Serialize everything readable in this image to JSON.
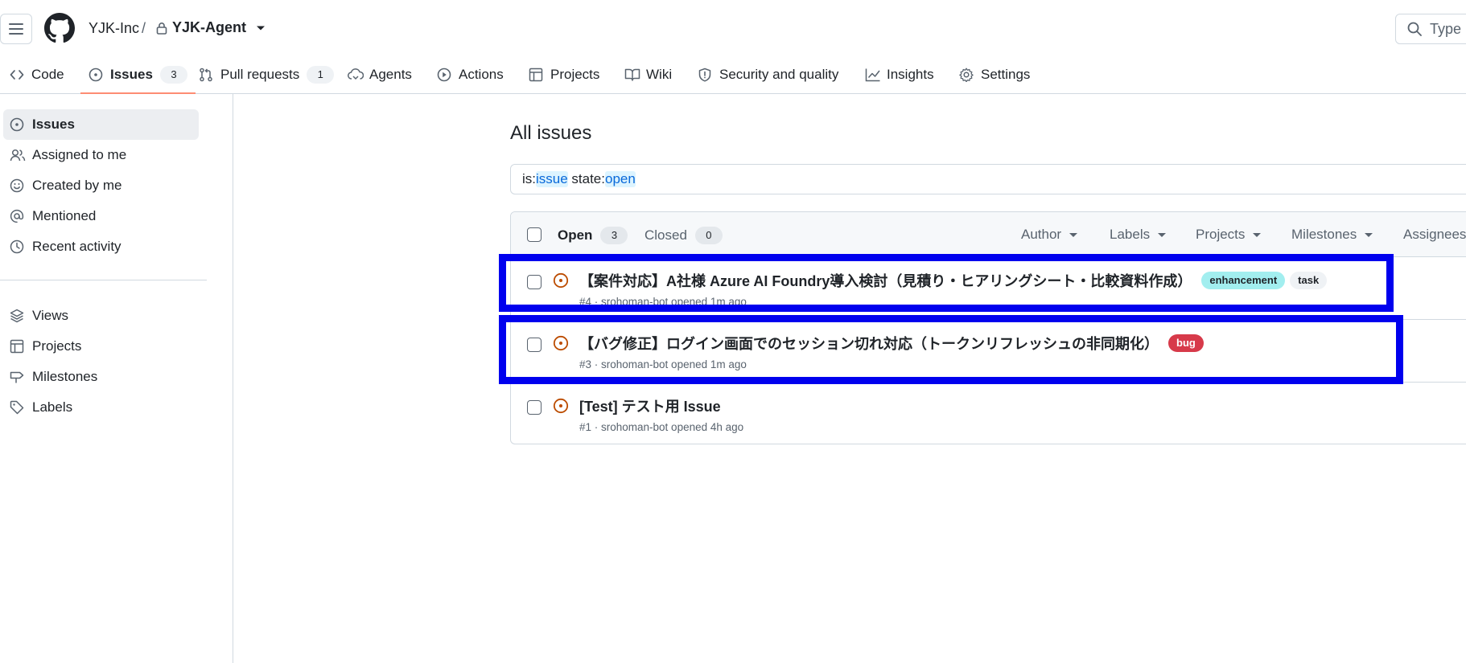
{
  "header": {
    "owner": "YJK-Inc",
    "separator": "/",
    "repo": "YJK-Agent",
    "search_placeholder": "Type ["
  },
  "repo_nav": {
    "code": "Code",
    "issues": "Issues",
    "issues_count": "3",
    "pull_requests": "Pull requests",
    "pull_requests_count": "1",
    "agents": "Agents",
    "actions": "Actions",
    "projects": "Projects",
    "wiki": "Wiki",
    "security": "Security and quality",
    "insights": "Insights",
    "settings": "Settings"
  },
  "sidebar": {
    "items": [
      {
        "label": "Issues",
        "icon": "issue-opened-icon"
      },
      {
        "label": "Assigned to me",
        "icon": "people-icon"
      },
      {
        "label": "Created by me",
        "icon": "smiley-icon"
      },
      {
        "label": "Mentioned",
        "icon": "mention-icon"
      },
      {
        "label": "Recent activity",
        "icon": "clock-icon"
      }
    ],
    "items2": [
      {
        "label": "Views",
        "icon": "stack-icon"
      },
      {
        "label": "Projects",
        "icon": "table-icon"
      },
      {
        "label": "Milestones",
        "icon": "milestone-icon"
      },
      {
        "label": "Labels",
        "icon": "tag-icon"
      }
    ]
  },
  "main": {
    "title": "All issues",
    "filter": {
      "k1": "is:",
      "v1": "issue",
      "k2": " state:",
      "v2": "open"
    },
    "tabs": {
      "open_label": "Open",
      "open_count": "3",
      "closed_label": "Closed",
      "closed_count": "0"
    },
    "header_filters": [
      "Author",
      "Labels",
      "Projects",
      "Milestones",
      "Assignees"
    ],
    "issues": [
      {
        "title": "【案件対応】A社様 Azure AI Foundry導入検討（見積り・ヒアリングシート・比較資料作成）",
        "meta": "#4 · srohoman-bot opened 1m ago",
        "labels": [
          {
            "name": "enhancement",
            "bg": "#a2eeef",
            "fg": "#1f2328"
          },
          {
            "name": "task",
            "bg": "#eff2f5",
            "fg": "#1f2328"
          }
        ]
      },
      {
        "title": "【バグ修正】ログイン画面でのセッション切れ対応（トークンリフレッシュの非同期化）",
        "meta": "#3 · srohoman-bot opened 1m ago",
        "labels": [
          {
            "name": "bug",
            "bg": "#d73a4a",
            "fg": "#ffffff"
          }
        ]
      },
      {
        "title": "[Test] テスト用 Issue",
        "meta": "#1 · srohoman-bot opened 4h ago",
        "labels": []
      }
    ]
  },
  "colors": {
    "accent_underline": "#fd8c73",
    "issue_open": "#bc4c00",
    "highlight": "#0000ee"
  }
}
